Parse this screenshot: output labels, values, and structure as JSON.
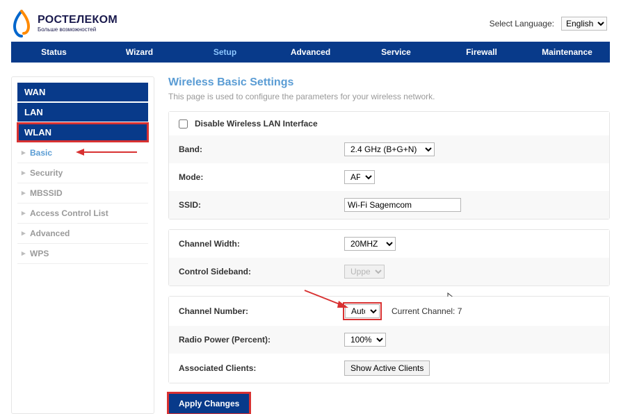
{
  "header": {
    "brand": "РОСТЕЛЕКОМ",
    "tagline": "Больше возможностей",
    "lang_label": "Select Language:",
    "lang_value": "English"
  },
  "nav": {
    "status": "Status",
    "wizard": "Wizard",
    "setup": "Setup",
    "advanced": "Advanced",
    "service": "Service",
    "firewall": "Firewall",
    "maintenance": "Maintenance"
  },
  "sidebar": {
    "wan": "WAN",
    "lan": "LAN",
    "wlan": "WLAN",
    "subs": {
      "basic": "Basic",
      "security": "Security",
      "mbssid": "MBSSID",
      "acl": "Access Control List",
      "advanced": "Advanced",
      "wps": "WPS"
    }
  },
  "page": {
    "title": "Wireless Basic Settings",
    "desc": "This page is used to configure the parameters for your wireless network."
  },
  "fields": {
    "disable_label": "Disable Wireless LAN Interface",
    "band_label": "Band:",
    "band_value": "2.4 GHz (B+G+N)",
    "mode_label": "Mode:",
    "mode_value": "AP",
    "ssid_label": "SSID:",
    "ssid_value": "Wi-Fi Sagemcom",
    "chwidth_label": "Channel Width:",
    "chwidth_value": "20MHZ",
    "sideband_label": "Control Sideband:",
    "sideband_value": "Upper",
    "chnum_label": "Channel Number:",
    "chnum_value": "Auto",
    "chnum_current": "Current Channel: 7",
    "radio_label": "Radio Power (Percent):",
    "radio_value": "100%",
    "assoc_label": "Associated Clients:",
    "assoc_btn": "Show Active Clients"
  },
  "actions": {
    "apply": "Apply Changes"
  }
}
